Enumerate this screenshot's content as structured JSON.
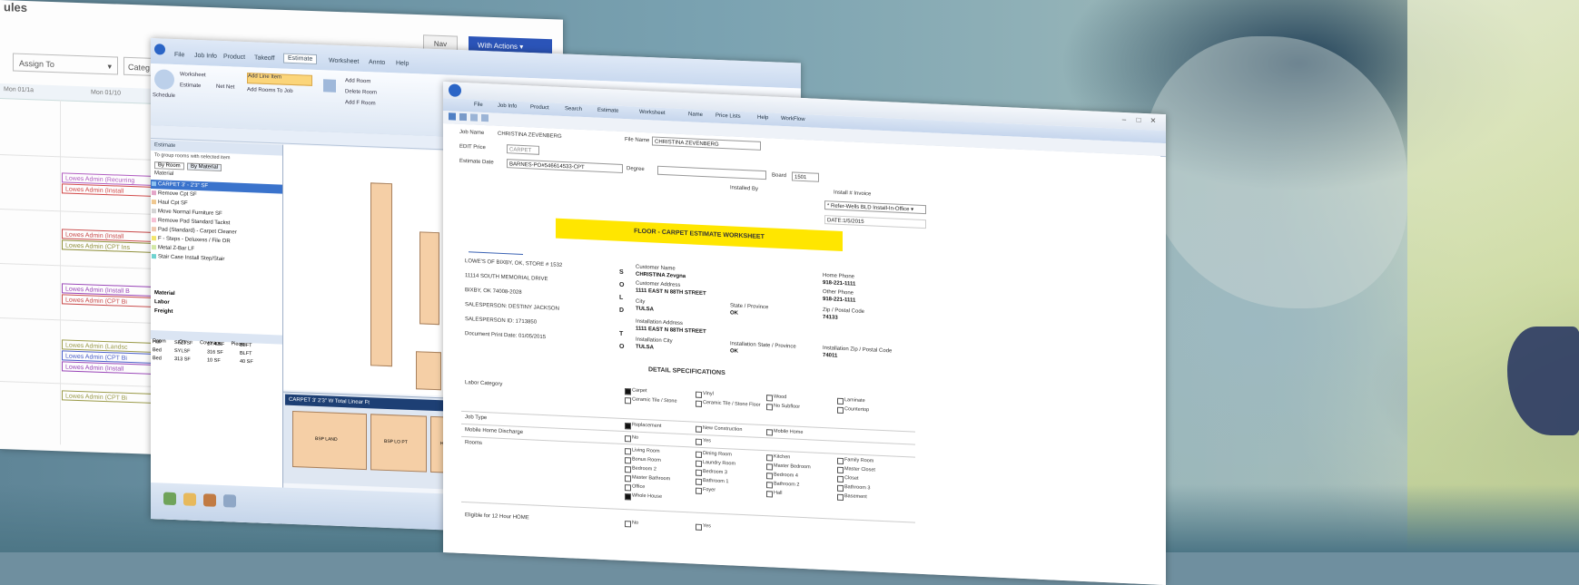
{
  "w1": {
    "title": "ules",
    "btn_new": "Nav",
    "btn_actions": "With Actions ▾",
    "assign_to": "Assign To",
    "category": "Categ",
    "header": [
      "Mon 01/1a",
      "Mon 01/10"
    ],
    "events": [
      {
        "label": "Lowes Admin (Recurring",
        "color": "#b05cc0"
      },
      {
        "label": "Lowes Admin (Install",
        "color": "#d24a4a"
      },
      {
        "label": "Lowes Admin (Install",
        "color": "#c94b4b"
      },
      {
        "label": "Lowes Admin (CPT Ins",
        "color": "#8f8f3a"
      },
      {
        "label": "Lowes Admin (Install B",
        "color": "#9a47b8"
      },
      {
        "label": "Lowes Admin (CPT Bi",
        "color": "#c94b4b"
      },
      {
        "label": "Lowes Admin (Landsc",
        "color": "#9b9b4a"
      },
      {
        "label": "Lowes Admin (CPT Bi",
        "color": "#4a5fc9"
      },
      {
        "label": "Lowes Admin (Install",
        "color": "#9a47b8"
      },
      {
        "label": "Lowes Admin (CPT Bi",
        "color": "#9b9b4a"
      }
    ]
  },
  "w2": {
    "tabs": [
      "File",
      "Job Info",
      "Product",
      "Takeoff",
      "Estimate",
      "Worksheet",
      "Annto",
      "Help"
    ],
    "ribbon": [
      "Schedule",
      "Worksheet",
      "Estimate",
      "Net Net",
      "Add Line Item",
      "Add Room",
      "Delete Room",
      "Add Rooms To Job",
      "Add F Room"
    ],
    "panel_title": "Estimate",
    "panel_note": "To group rooms with selected item",
    "panel_tabs": [
      "By Room",
      "By Material"
    ],
    "materials": [
      {
        "label": "CARPET 3' - 2'3\" SF",
        "color": "#8ec3f0",
        "sel": true
      },
      {
        "label": "Remove Cpt SF",
        "color": "#e4a5c8"
      },
      {
        "label": "Haul Cpt SF",
        "color": "#f0c890"
      },
      {
        "label": "Move Normal Furniture SF",
        "color": "#d4d4d4"
      },
      {
        "label": "Remove Pad Standard Tackst",
        "color": "#f7c0d4"
      },
      {
        "label": "Pad (Standard) - Carpet Cleaner",
        "color": "#f0c8b0"
      },
      {
        "label": "F - Steps - Deluxess / File OR",
        "color": "#f2e56b"
      },
      {
        "label": "Metal Z-Bar LF",
        "color": "#d2e8a6"
      },
      {
        "label": "Stair Case Install Step/Stair",
        "color": "#6fd3d0"
      }
    ],
    "panel_sections": [
      "Material",
      "Labor",
      "Freight"
    ],
    "strip_title": "CARPET 3' 2'3\" W    Total Linear Ft",
    "table_cols": [
      "Room",
      "Qty",
      "Coverage",
      "Pieces"
    ],
    "table_rows": [
      [
        "Hall",
        "SELTSF",
        "17.4 SF",
        "BLFT"
      ],
      [
        "Bed",
        "SYLSF",
        "316 SF",
        "BLFT"
      ],
      [
        "Bed",
        "313 SF",
        "10 SF",
        "40 SF"
      ]
    ],
    "plan_labels": [
      "BSP LAND",
      "BSP LO PT",
      "Hall"
    ]
  },
  "w3": {
    "menu": [
      "File",
      "Job Info",
      "Product",
      "Search",
      "Estimate",
      "Worksheet",
      "Name",
      "Price Lists",
      "Help",
      "WorkFlow"
    ],
    "job_name_label": "Job Name",
    "job_name_value": "CHRISTINA ZEVENBERG",
    "file_name_label": "File Name",
    "file_name_value": "CHRISTINA ZEVENBERG",
    "edit_price_label": "EDIT Price",
    "edit_price_value": "CARPET",
    "estimate_date_label": "Estimate Date",
    "estimate_date_value": "BARNES-PO#546614533-CPT",
    "degree_label": "Degree",
    "board_label": "Board",
    "board_value": "1501",
    "install_by_label": "Installed By",
    "install_inv_label": "Install # Invoice",
    "install_inv_value": "* Refer-Wells BLD Install-In-Office ▾",
    "date_value": "DATE:1/5/2015",
    "banner": "FLOOR - CARPET ESTIMATE WORKSHEET",
    "store": [
      "LOWE'S OF BIXBY, OK, STORE # 1532",
      "11114 SOUTH MEMORIAL DRIVE",
      "BIXBY, OK 74008-2028",
      "SALESPERSON: DESTINY JACKSON",
      "SALESPERSON ID: 1713850",
      "Document Print Date: 01/05/2015"
    ],
    "letters": [
      "S",
      "O",
      "L",
      "D",
      "T",
      "O"
    ],
    "customer_name_label": "Customer Name",
    "customer_name": "CHRISTINA Zevgna",
    "customer_addr_label": "Customer Address",
    "customer_addr": "1111 EAST N 88TH STREET",
    "city_label": "City",
    "city": "TULSA",
    "state_label": "State / Province",
    "state": "OK",
    "zip_label": "Zip / Postal Code",
    "zip": "74133",
    "home_phone_label": "Home Phone",
    "home_phone": "918-221-1111",
    "other_phone_label": "Other Phone",
    "other_phone": "918-221-1111",
    "install_addr_label": "Installation Address",
    "install_addr": "1111 EAST N 88TH STREET",
    "install_city_label": "Installation City",
    "install_city": "TULSA",
    "install_state_label": "Installation State / Province",
    "install_state": "OK",
    "install_zip_label": "Installation Zip / Postal Code",
    "install_zip": "74011",
    "detail_title": "DETAIL SPECIFICATIONS",
    "labor_cat_label": "Labor Category",
    "labor_cats": [
      {
        "t": "Carpet",
        "on": true
      },
      {
        "t": "Vinyl"
      },
      {
        "t": "Wood"
      },
      {
        "t": "Laminate"
      },
      {
        "t": "Ceramic Tile / Stone"
      },
      {
        "t": "Ceramic Tile / Stone Floor"
      },
      {
        "t": "No Subfloor"
      },
      {
        "t": "Countertop"
      }
    ],
    "job_type_label": "Job Type",
    "job_types": [
      {
        "t": "Replacement",
        "on": true
      },
      {
        "t": "New Construction"
      },
      {
        "t": "Mobile Home"
      }
    ],
    "mobile_label": "Mobile Home Discharge",
    "mobile_opts": [
      {
        "t": "No"
      },
      {
        "t": "Yes"
      }
    ],
    "rooms_label": "Rooms",
    "rooms": [
      {
        "t": "Living Room"
      },
      {
        "t": "Dining Room"
      },
      {
        "t": "Kitchen"
      },
      {
        "t": "Family Room"
      },
      {
        "t": "Bonus Room"
      },
      {
        "t": "Laundry Room"
      },
      {
        "t": "Master Bedroom"
      },
      {
        "t": "Master Closet"
      },
      {
        "t": "Bedroom 2"
      },
      {
        "t": "Bedroom 3"
      },
      {
        "t": "Bedroom 4"
      },
      {
        "t": "Closet"
      },
      {
        "t": "Master Bathroom"
      },
      {
        "t": "Bathroom 1"
      },
      {
        "t": "Bathroom 2"
      },
      {
        "t": "Bathroom 3"
      },
      {
        "t": "Office"
      },
      {
        "t": "Foyer"
      },
      {
        "t": "Hall"
      },
      {
        "t": "Basement"
      },
      {
        "t": "Whole House",
        "on": true
      }
    ],
    "eligible_label": "Eligible for 12 Hour HOME",
    "eligible_opts": [
      {
        "t": "No"
      },
      {
        "t": "Yes"
      }
    ]
  }
}
